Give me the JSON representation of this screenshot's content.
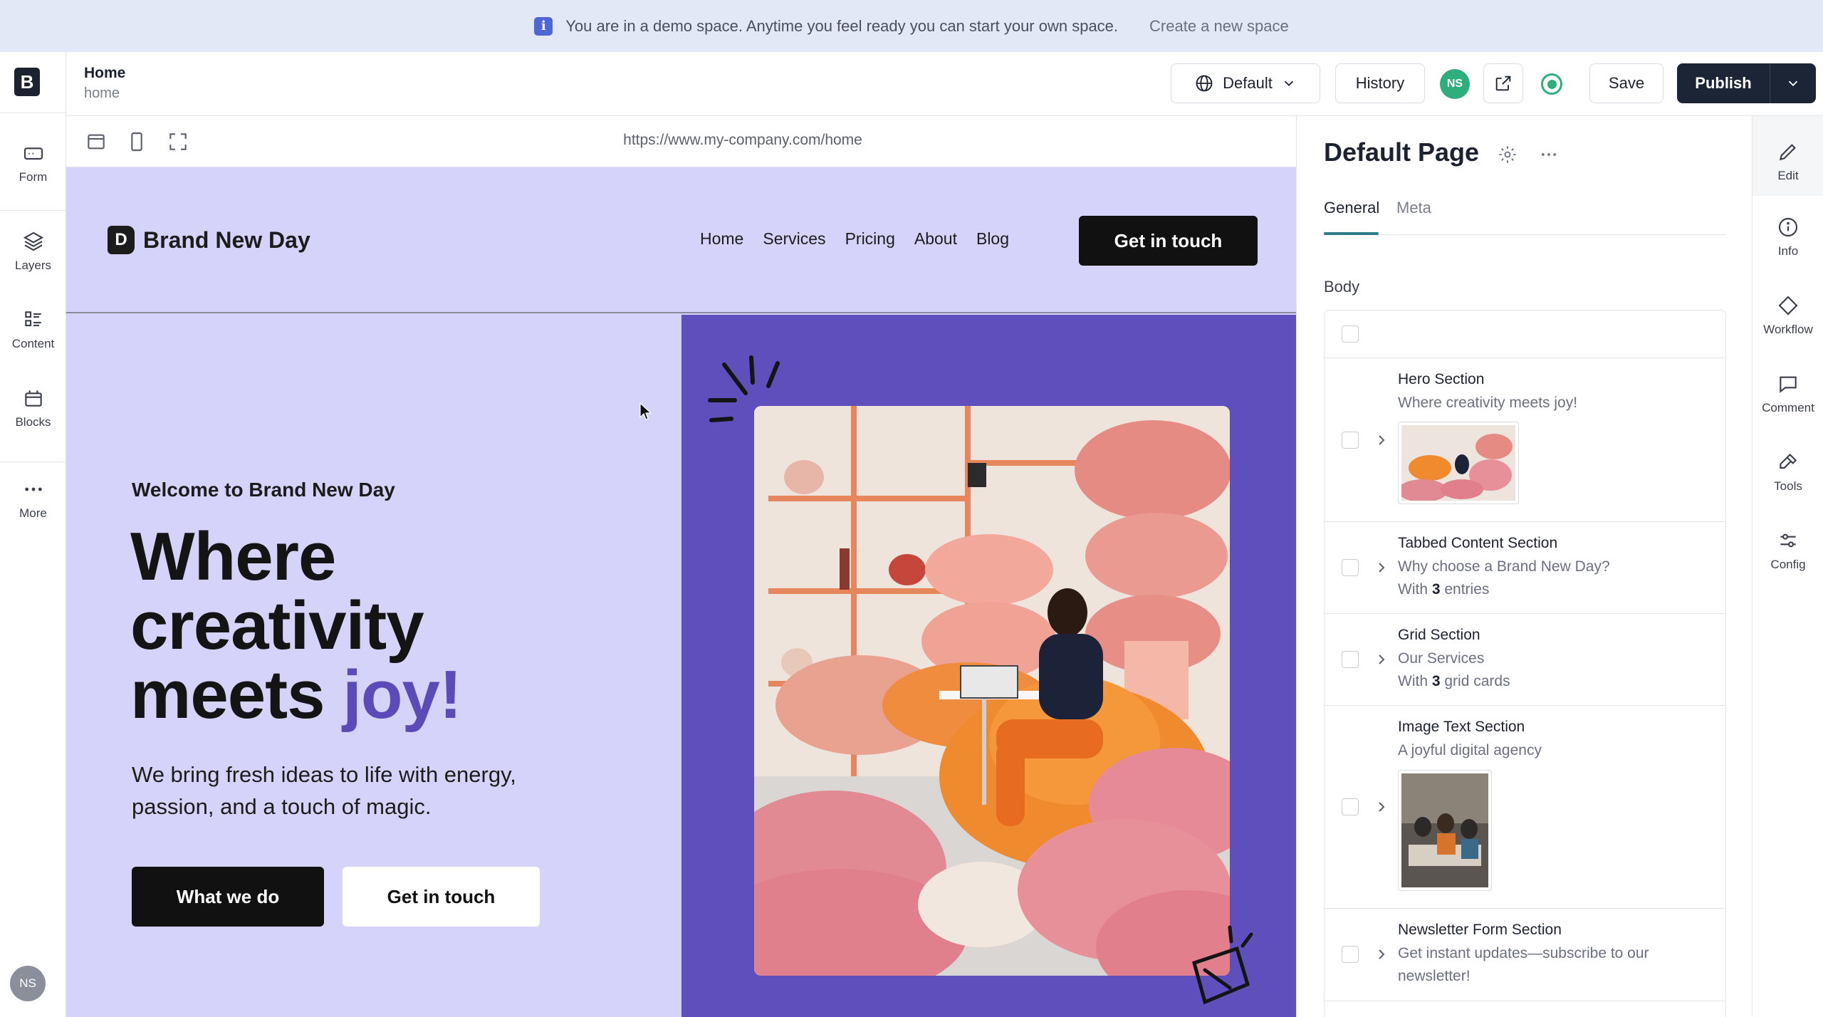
{
  "banner": {
    "message": "You are in a demo space. Anytime you feel ready you can start your own space.",
    "link": "Create a new space"
  },
  "left_rail": {
    "logo": "B",
    "items": [
      {
        "label": "Form",
        "icon": "form-icon"
      },
      {
        "label": "Layers",
        "icon": "layers-icon"
      },
      {
        "label": "Content",
        "icon": "content-icon"
      },
      {
        "label": "Blocks",
        "icon": "blocks-icon"
      },
      {
        "label": "More",
        "icon": "more-icon"
      }
    ],
    "avatar": "NS"
  },
  "topbar": {
    "title": "Home",
    "slug": "home",
    "locale": "Default",
    "history": "History",
    "avatar": "NS",
    "save": "Save",
    "publish": "Publish"
  },
  "canvas": {
    "url": "https://www.my-company.com/home"
  },
  "site": {
    "logo_letter": "D",
    "brand": "Brand New Day",
    "nav": [
      "Home",
      "Services",
      "Pricing",
      "About",
      "Blog"
    ],
    "cta": "Get in touch",
    "kicker": "Welcome to Brand New Day",
    "headline_1": "Where",
    "headline_2": "creativity",
    "headline_3": "meets ",
    "headline_accent": "joy!",
    "subtext": "We bring fresh ideas to life with energy, passion, and a touch of magic.",
    "btn_primary": "What we do",
    "btn_secondary": "Get in touch",
    "accent_color": "#5b4ab8",
    "bg_color": "#d6d3fa",
    "panel_color": "#5e4fbc"
  },
  "panel": {
    "title": "Default Page",
    "tabs": [
      "General",
      "Meta"
    ],
    "body_label": "Body",
    "sections": [
      {
        "title": "Hero Section",
        "subtitle": "Where creativity meets joy!"
      },
      {
        "title": "Tabbed Content Section",
        "subtitle": "Why choose a Brand New Day?",
        "meta_prefix": "With ",
        "meta_count": "3",
        "meta_suffix": " entries"
      },
      {
        "title": "Grid Section",
        "subtitle": "Our Services",
        "meta_prefix": "With ",
        "meta_count": "3",
        "meta_suffix": " grid cards"
      },
      {
        "title": "Image Text Section",
        "subtitle": "A joyful digital agency"
      },
      {
        "title": "Newsletter Form Section",
        "subtitle_1": "Get instant updates—subscribe to our",
        "subtitle_2": "newsletter!"
      }
    ]
  },
  "right_rail": {
    "items": [
      {
        "label": "Edit",
        "icon": "pencil-icon"
      },
      {
        "label": "Info",
        "icon": "info-icon"
      },
      {
        "label": "Workflow",
        "icon": "workflow-icon"
      },
      {
        "label": "Comment",
        "icon": "comment-icon"
      },
      {
        "label": "Tools",
        "icon": "tools-icon"
      },
      {
        "label": "Config",
        "icon": "config-icon"
      }
    ]
  }
}
